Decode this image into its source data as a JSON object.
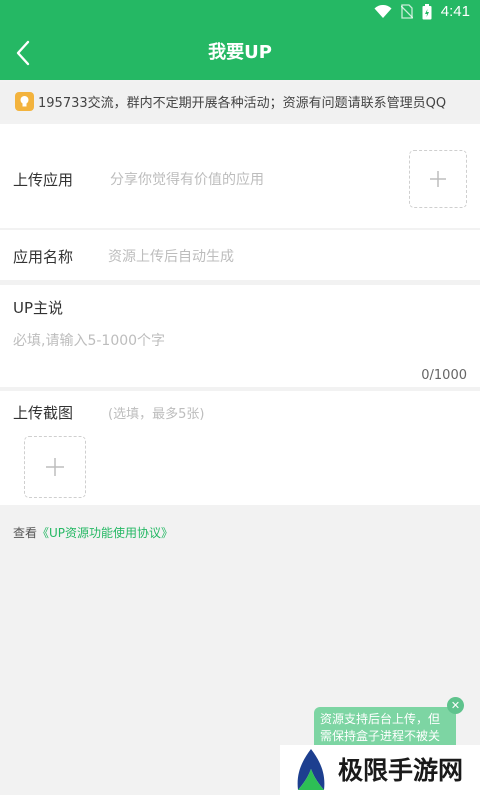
{
  "status_bar": {
    "time": "4:41"
  },
  "header": {
    "title": "我要UP"
  },
  "notice": {
    "text": "195733交流，群内不定期开展各种活动；资源有问题请联系管理员QQ"
  },
  "upload_app": {
    "label": "上传应用",
    "hint": "分享你觉得有价值的应用"
  },
  "app_name": {
    "label": "应用名称",
    "hint": "资源上传后自动生成"
  },
  "up_says": {
    "label": "UP主说",
    "placeholder": "必填,请输入5-1000个字",
    "counter": "0/1000"
  },
  "screenshots": {
    "label": "上传截图",
    "hint": "(选填，最多5张)"
  },
  "agreement": {
    "prefix": "查看",
    "link": "《UP资源功能使用协议》"
  },
  "toast": {
    "text": "资源支持后台上传，但需保持盒子进程不被关"
  },
  "watermark": {
    "text": "极限手游网"
  },
  "colors": {
    "brand": "#25b864",
    "toast": "#7dd5a3",
    "bulb": "#f3b33d"
  }
}
